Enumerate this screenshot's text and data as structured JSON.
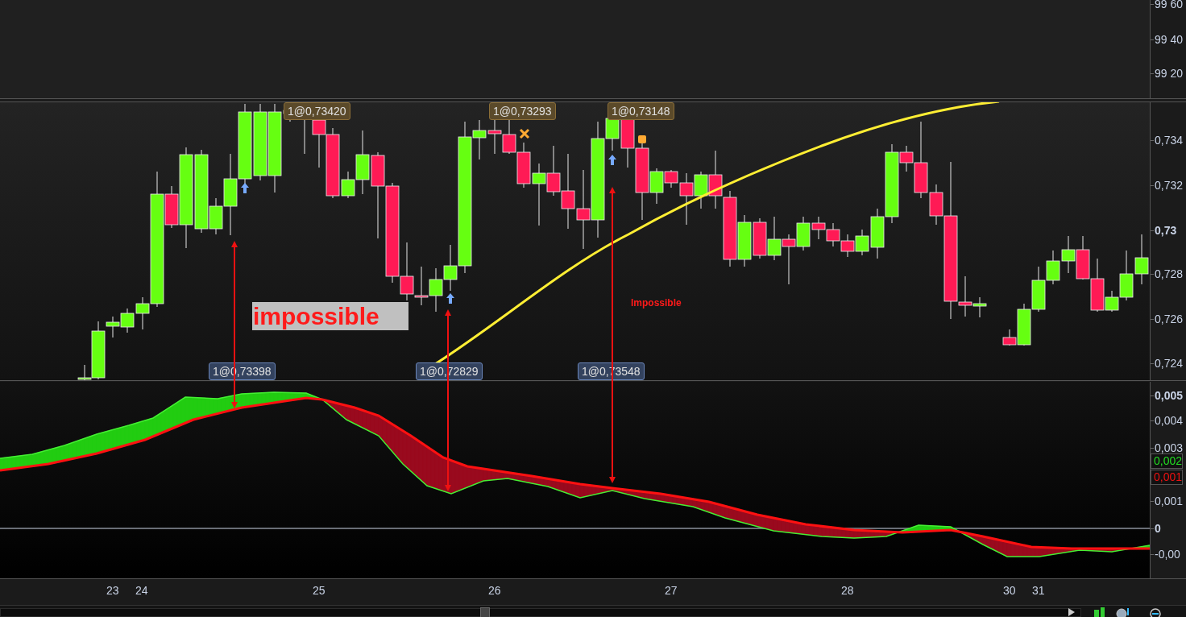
{
  "upper_pane": {
    "axis_labels": [
      {
        "text": "99 60",
        "emphasized": false
      },
      {
        "text": "99 40",
        "emphasized": false
      },
      {
        "text": "99 20",
        "emphasized": false
      }
    ]
  },
  "price_pane": {
    "axis_labels": [
      {
        "text": "0,734",
        "emphasized": false
      },
      {
        "text": "0,732",
        "emphasized": false
      },
      {
        "text": "0,73",
        "emphasized": true
      },
      {
        "text": "0,728",
        "emphasized": false
      },
      {
        "text": "0,726",
        "emphasized": false
      },
      {
        "text": "0,724",
        "emphasized": false
      }
    ],
    "trade_labels": [
      {
        "text": "1@0,73420",
        "kind": "sell"
      },
      {
        "text": "1@0,73293",
        "kind": "sell"
      },
      {
        "text": "1@0,73148",
        "kind": "sell"
      },
      {
        "text": "1@0,73398",
        "kind": "buy"
      },
      {
        "text": "1@0,72829",
        "kind": "buy"
      },
      {
        "text": "1@0,73548",
        "kind": "buy"
      }
    ],
    "annotations": [
      {
        "text": "impossible",
        "kind": "boxed"
      },
      {
        "text": "Impossible",
        "kind": "plain"
      }
    ]
  },
  "indicator_pane": {
    "axis_labels": [
      {
        "text": "0,005",
        "kind": "tick",
        "emphasized": true
      },
      {
        "text": "0,004",
        "kind": "tick",
        "emphasized": false
      },
      {
        "text": "0,003",
        "kind": "tick",
        "emphasized": false
      },
      {
        "text": "0,002",
        "kind": "badge",
        "color": "#22dd22",
        "emphasized": false
      },
      {
        "text": "0,001",
        "kind": "badge",
        "color": "#ee1111",
        "emphasized": false
      },
      {
        "text": "0,001",
        "kind": "tick",
        "emphasized": false
      },
      {
        "text": "0",
        "kind": "tick",
        "emphasized": true
      },
      {
        "text": "-0,00",
        "kind": "tick",
        "emphasized": false
      }
    ]
  },
  "time_axis": {
    "labels": [
      "23",
      "24",
      "25",
      "26",
      "27",
      "28",
      "30",
      "31"
    ]
  }
}
